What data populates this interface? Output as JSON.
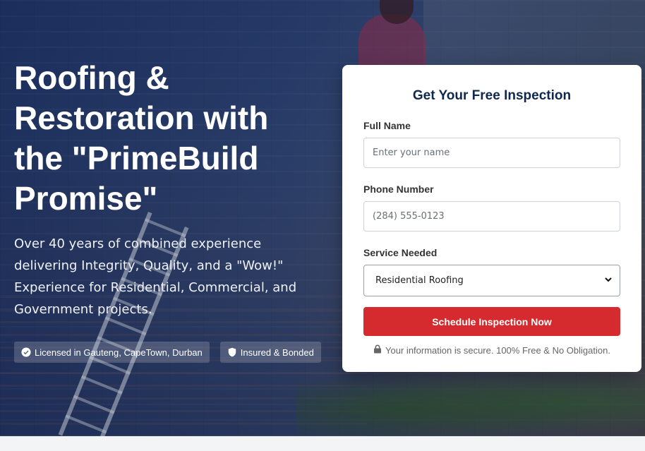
{
  "hero": {
    "headline": "Roofing & Restoration with the \"PrimeBuild Promise\"",
    "subtext": "Over 40 years of combined experience delivering Integrity, Quality, and a \"Wow!\" Experience for Residential, Commercial, and Government projects.",
    "badges": [
      {
        "icon": "check-circle-icon",
        "label": "Licensed in Gauteng, CapeTown, Durban"
      },
      {
        "icon": "shield-icon",
        "label": "Insured & Bonded"
      }
    ]
  },
  "form": {
    "title": "Get Your Free Inspection",
    "full_name": {
      "label": "Full Name",
      "placeholder": "Enter your name"
    },
    "phone": {
      "label": "Phone Number",
      "placeholder": "(284) 555-0123"
    },
    "service": {
      "label": "Service Needed",
      "selected": "Residential Roofing"
    },
    "submit_label": "Schedule Inspection Now",
    "secure_note": "Your information is secure. 100% Free & No Obligation.",
    "colors": {
      "accent": "#d52b2e",
      "title": "#10284d"
    }
  }
}
